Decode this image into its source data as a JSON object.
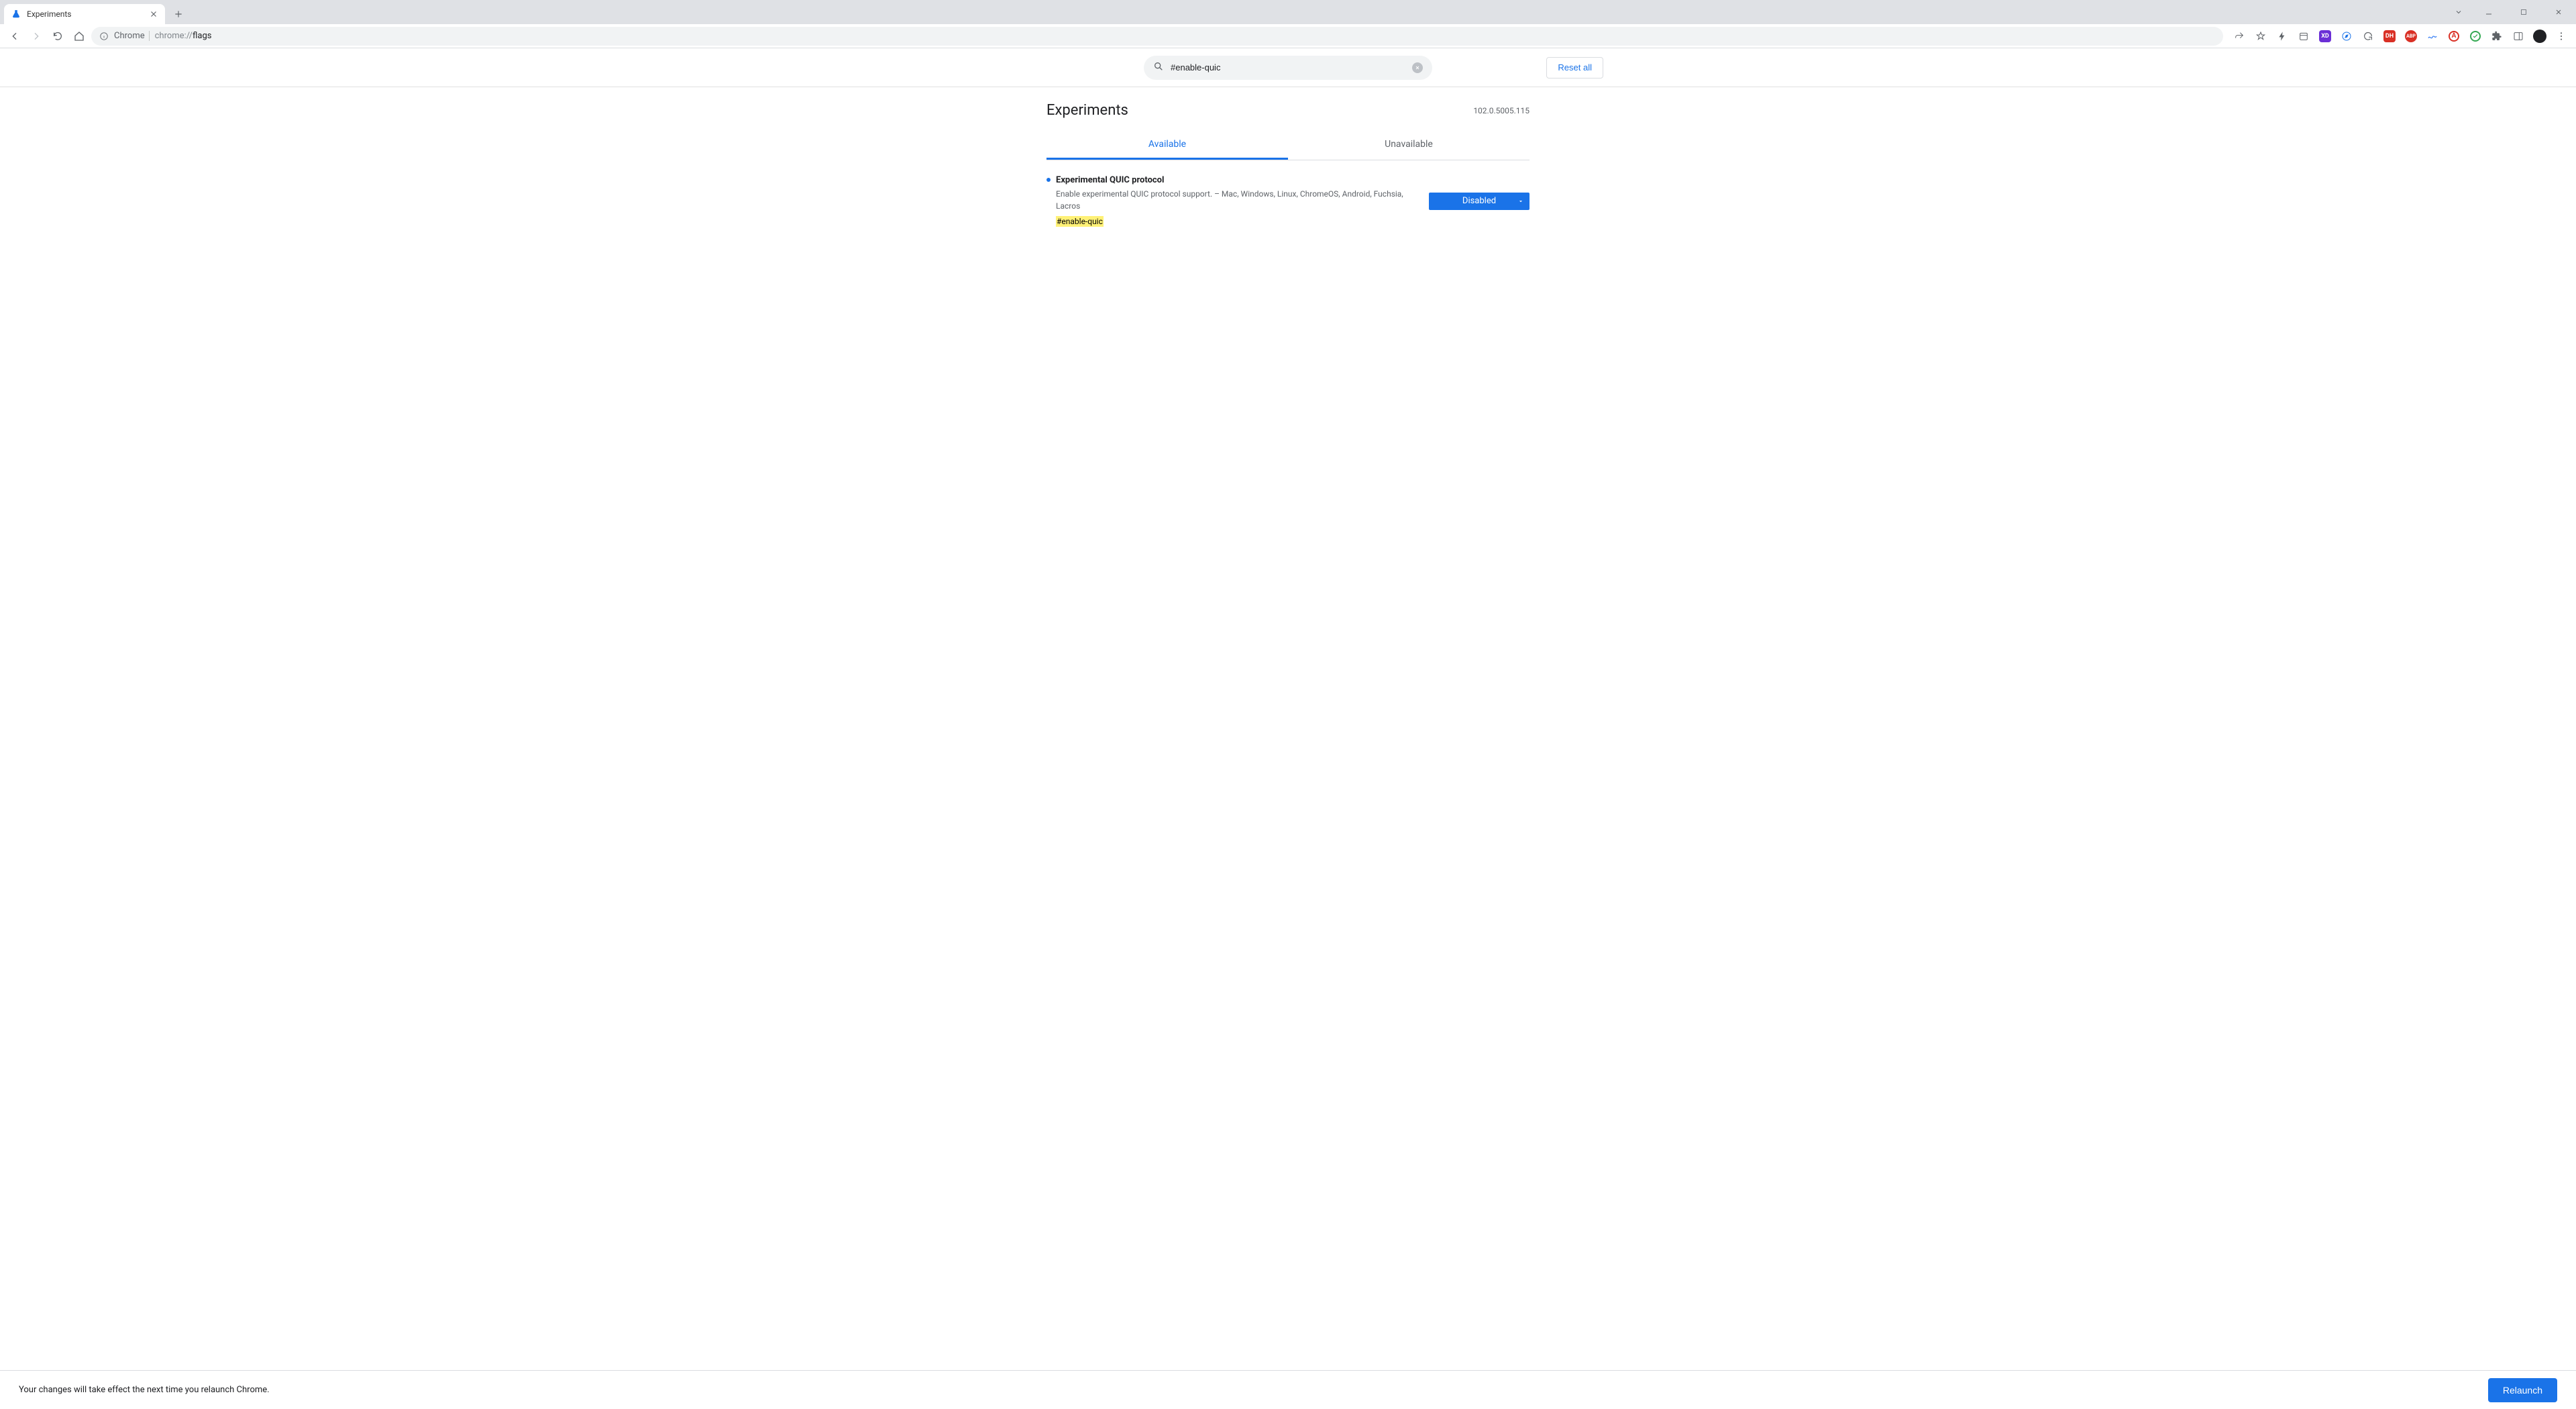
{
  "window": {
    "tab_title": "Experiments"
  },
  "toolbar": {
    "chip": "Chrome",
    "url_prefix": "chrome://",
    "url_suffix": "flags"
  },
  "extensions": [
    {
      "name": "share-icon"
    },
    {
      "name": "star-icon"
    },
    {
      "name": "bolt-icon"
    },
    {
      "name": "calendar-icon"
    },
    {
      "name": "xd-icon",
      "bg": "#6b2fd6",
      "txt": "XD"
    },
    {
      "name": "compass-icon"
    },
    {
      "name": "refresh-ext-icon"
    },
    {
      "name": "dh-icon",
      "bg": "#d93025",
      "txt": "DH"
    },
    {
      "name": "abp-icon",
      "bg": "#d93025",
      "txt": "ABP"
    },
    {
      "name": "wave-icon",
      "bg": "#4285f4"
    },
    {
      "name": "a-circle-icon",
      "bg": "#d93025",
      "txt": "A"
    },
    {
      "name": "check-icon",
      "bg": "#34a853"
    },
    {
      "name": "puzzle-icon"
    },
    {
      "name": "panel-icon"
    }
  ],
  "search": {
    "value": "#enable-quic"
  },
  "reset_label": "Reset all",
  "page_title": "Experiments",
  "version": "102.0.5005.115",
  "tabs": {
    "available": "Available",
    "unavailable": "Unavailable"
  },
  "flag": {
    "title": "Experimental QUIC protocol",
    "desc": "Enable experimental QUIC protocol support. – Mac, Windows, Linux, ChromeOS, Android, Fuchsia, Lacros",
    "hash": "#enable-quic",
    "select_value": "Disabled"
  },
  "relaunch": {
    "message": "Your changes will take effect the next time you relaunch Chrome.",
    "button": "Relaunch"
  }
}
